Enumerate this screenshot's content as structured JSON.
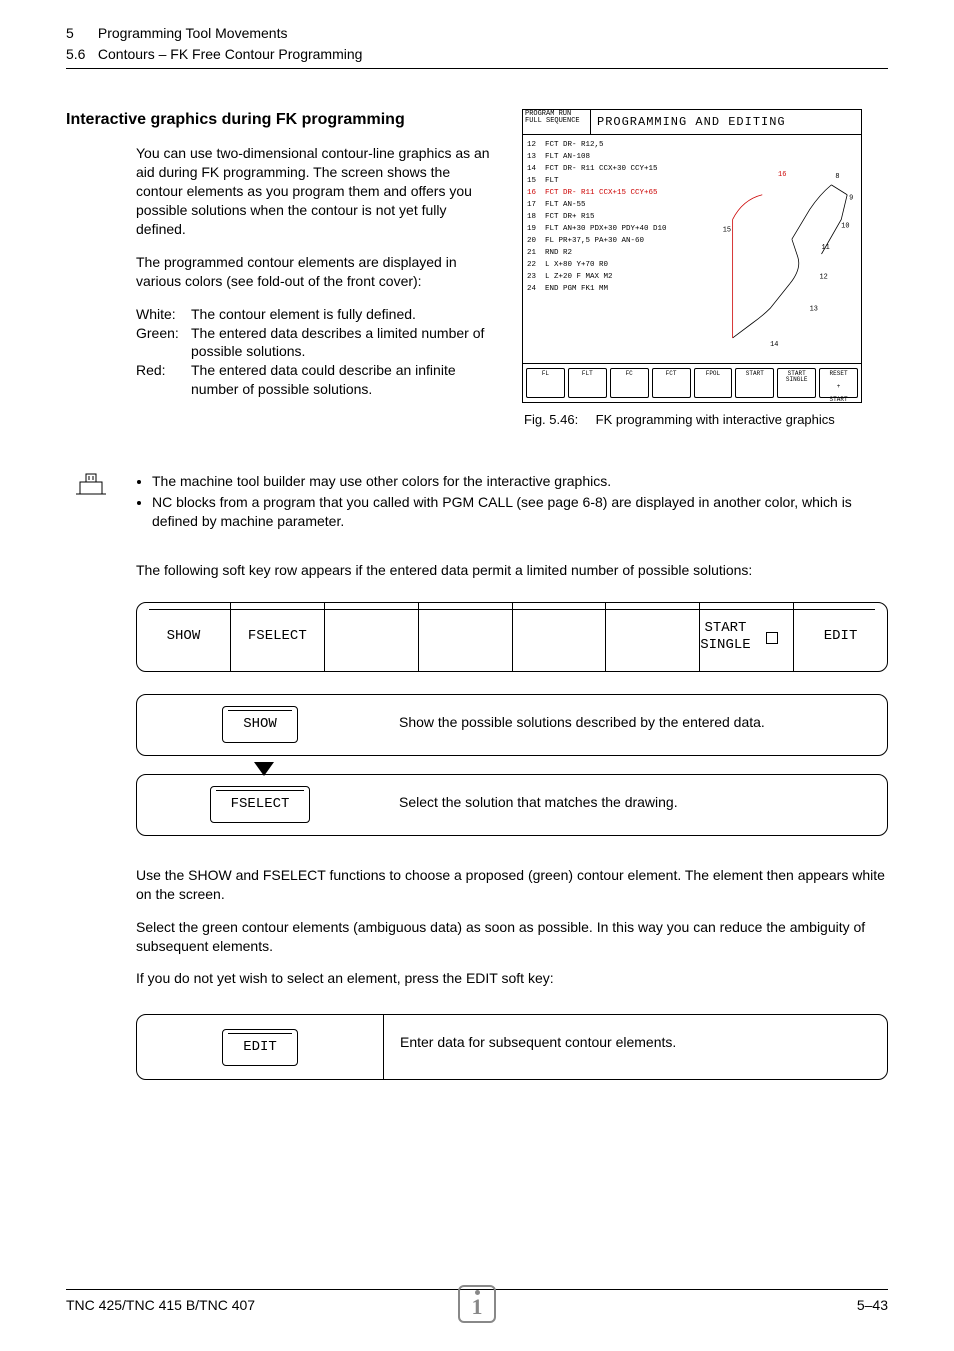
{
  "header": {
    "chapter_num": "5",
    "chapter_title": "Programming Tool Movements",
    "section_num": "5.6",
    "section_title": "Contours – FK Free Contour Programming"
  },
  "heading": "Interactive graphics during FK programming",
  "intro_p1": "You can use two-dimensional contour-line graphics as an aid during FK programming.  The screen shows the contour elements as you program them and offers you possible solutions when the contour is not yet fully defined.",
  "intro_p2": "The programmed contour elements are displayed in various colors (see fold-out of the front cover):",
  "colors": {
    "white_label": "White:",
    "white_desc": "The contour element is fully defined.",
    "green_label": "Green:",
    "green_desc": "The entered data describes a limited number of possible solutions.",
    "red_label": "Red:",
    "red_desc": "The entered data could describe an infinite number of possible solutions."
  },
  "figure": {
    "mode_top": "PROGRAM RUN",
    "mode_bottom": "FULL SEQUENCE",
    "title": "PROGRAMMING AND EDITING",
    "lines": [
      "12  FCT DR- R12,5",
      "13  FLT AN-108",
      "14  FCT DR- R11 CCX+30 CCY+15",
      "15  FLT",
      "16  FCT DR- R11 CCX+15 CCY+65",
      "17  FLT AN-55",
      "18  FCT DR+ R15",
      "19  FLT AN+30 PDX+30 PDY+40 D10",
      "20  FL PR+37,5 PA+30 AN-60",
      "21  RND R2",
      "22  L X+80 Y+70 R0",
      "23  L Z+20 F MAX M2",
      "24  END PGM FK1 MM"
    ],
    "highlight_index": 4,
    "pt_labels": [
      "8",
      "9",
      "10",
      "11",
      "12",
      "13",
      "14",
      "15",
      "16"
    ],
    "softkeys": [
      "FL",
      "FLT",
      "FC",
      "FCT",
      "FPOL",
      "START",
      "START SINGLE",
      "RESET + START"
    ],
    "caption_num": "Fig. 5.46:",
    "caption_text": "FK programming with interactive graphics"
  },
  "notes": {
    "b1": "The machine tool builder may use other colors for the interactive graphics.",
    "b2": "NC blocks from a program that you called with PGM CALL (see page 6-8) are displayed in another color, which is defined by machine parameter."
  },
  "para_limited": "The following soft key row appears if the entered data permit a limited number of possible solutions:",
  "softkey_bar": [
    "SHOW",
    "FSELECT",
    "",
    "",
    "",
    "",
    "START\nSINGLE",
    "EDIT"
  ],
  "desc": {
    "show_key": "SHOW",
    "show_text": "Show the possible solutions described by the entered data.",
    "fselect_key": "FSELECT",
    "fselect_text": "Select the solution that matches the drawing."
  },
  "para_use": "Use the SHOW and FSELECT functions to choose a proposed (green) contour element. The element then appears white on the screen.",
  "para_green": "Select the green contour elements (ambiguous data) as soon as possible. In this way you can reduce the ambiguity of subsequent elements.",
  "para_edit": "If you do not yet wish to select an element, press the EDIT soft key:",
  "edit_row": {
    "key": "EDIT",
    "text": "Enter data for subsequent contour elements."
  },
  "footer": {
    "left": "TNC 425/TNC 415 B/TNC 407",
    "right": "5–43"
  }
}
